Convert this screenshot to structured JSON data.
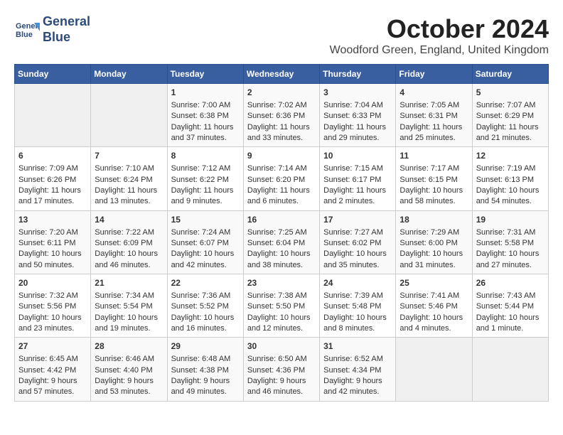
{
  "logo": {
    "line1": "General",
    "line2": "Blue"
  },
  "title": "October 2024",
  "location": "Woodford Green, England, United Kingdom",
  "headers": [
    "Sunday",
    "Monday",
    "Tuesday",
    "Wednesday",
    "Thursday",
    "Friday",
    "Saturday"
  ],
  "weeks": [
    [
      {
        "day": "",
        "sunrise": "",
        "sunset": "",
        "daylight": ""
      },
      {
        "day": "",
        "sunrise": "",
        "sunset": "",
        "daylight": ""
      },
      {
        "day": "1",
        "sunrise": "Sunrise: 7:00 AM",
        "sunset": "Sunset: 6:38 PM",
        "daylight": "Daylight: 11 hours and 37 minutes."
      },
      {
        "day": "2",
        "sunrise": "Sunrise: 7:02 AM",
        "sunset": "Sunset: 6:36 PM",
        "daylight": "Daylight: 11 hours and 33 minutes."
      },
      {
        "day": "3",
        "sunrise": "Sunrise: 7:04 AM",
        "sunset": "Sunset: 6:33 PM",
        "daylight": "Daylight: 11 hours and 29 minutes."
      },
      {
        "day": "4",
        "sunrise": "Sunrise: 7:05 AM",
        "sunset": "Sunset: 6:31 PM",
        "daylight": "Daylight: 11 hours and 25 minutes."
      },
      {
        "day": "5",
        "sunrise": "Sunrise: 7:07 AM",
        "sunset": "Sunset: 6:29 PM",
        "daylight": "Daylight: 11 hours and 21 minutes."
      }
    ],
    [
      {
        "day": "6",
        "sunrise": "Sunrise: 7:09 AM",
        "sunset": "Sunset: 6:26 PM",
        "daylight": "Daylight: 11 hours and 17 minutes."
      },
      {
        "day": "7",
        "sunrise": "Sunrise: 7:10 AM",
        "sunset": "Sunset: 6:24 PM",
        "daylight": "Daylight: 11 hours and 13 minutes."
      },
      {
        "day": "8",
        "sunrise": "Sunrise: 7:12 AM",
        "sunset": "Sunset: 6:22 PM",
        "daylight": "Daylight: 11 hours and 9 minutes."
      },
      {
        "day": "9",
        "sunrise": "Sunrise: 7:14 AM",
        "sunset": "Sunset: 6:20 PM",
        "daylight": "Daylight: 11 hours and 6 minutes."
      },
      {
        "day": "10",
        "sunrise": "Sunrise: 7:15 AM",
        "sunset": "Sunset: 6:17 PM",
        "daylight": "Daylight: 11 hours and 2 minutes."
      },
      {
        "day": "11",
        "sunrise": "Sunrise: 7:17 AM",
        "sunset": "Sunset: 6:15 PM",
        "daylight": "Daylight: 10 hours and 58 minutes."
      },
      {
        "day": "12",
        "sunrise": "Sunrise: 7:19 AM",
        "sunset": "Sunset: 6:13 PM",
        "daylight": "Daylight: 10 hours and 54 minutes."
      }
    ],
    [
      {
        "day": "13",
        "sunrise": "Sunrise: 7:20 AM",
        "sunset": "Sunset: 6:11 PM",
        "daylight": "Daylight: 10 hours and 50 minutes."
      },
      {
        "day": "14",
        "sunrise": "Sunrise: 7:22 AM",
        "sunset": "Sunset: 6:09 PM",
        "daylight": "Daylight: 10 hours and 46 minutes."
      },
      {
        "day": "15",
        "sunrise": "Sunrise: 7:24 AM",
        "sunset": "Sunset: 6:07 PM",
        "daylight": "Daylight: 10 hours and 42 minutes."
      },
      {
        "day": "16",
        "sunrise": "Sunrise: 7:25 AM",
        "sunset": "Sunset: 6:04 PM",
        "daylight": "Daylight: 10 hours and 38 minutes."
      },
      {
        "day": "17",
        "sunrise": "Sunrise: 7:27 AM",
        "sunset": "Sunset: 6:02 PM",
        "daylight": "Daylight: 10 hours and 35 minutes."
      },
      {
        "day": "18",
        "sunrise": "Sunrise: 7:29 AM",
        "sunset": "Sunset: 6:00 PM",
        "daylight": "Daylight: 10 hours and 31 minutes."
      },
      {
        "day": "19",
        "sunrise": "Sunrise: 7:31 AM",
        "sunset": "Sunset: 5:58 PM",
        "daylight": "Daylight: 10 hours and 27 minutes."
      }
    ],
    [
      {
        "day": "20",
        "sunrise": "Sunrise: 7:32 AM",
        "sunset": "Sunset: 5:56 PM",
        "daylight": "Daylight: 10 hours and 23 minutes."
      },
      {
        "day": "21",
        "sunrise": "Sunrise: 7:34 AM",
        "sunset": "Sunset: 5:54 PM",
        "daylight": "Daylight: 10 hours and 19 minutes."
      },
      {
        "day": "22",
        "sunrise": "Sunrise: 7:36 AM",
        "sunset": "Sunset: 5:52 PM",
        "daylight": "Daylight: 10 hours and 16 minutes."
      },
      {
        "day": "23",
        "sunrise": "Sunrise: 7:38 AM",
        "sunset": "Sunset: 5:50 PM",
        "daylight": "Daylight: 10 hours and 12 minutes."
      },
      {
        "day": "24",
        "sunrise": "Sunrise: 7:39 AM",
        "sunset": "Sunset: 5:48 PM",
        "daylight": "Daylight: 10 hours and 8 minutes."
      },
      {
        "day": "25",
        "sunrise": "Sunrise: 7:41 AM",
        "sunset": "Sunset: 5:46 PM",
        "daylight": "Daylight: 10 hours and 4 minutes."
      },
      {
        "day": "26",
        "sunrise": "Sunrise: 7:43 AM",
        "sunset": "Sunset: 5:44 PM",
        "daylight": "Daylight: 10 hours and 1 minute."
      }
    ],
    [
      {
        "day": "27",
        "sunrise": "Sunrise: 6:45 AM",
        "sunset": "Sunset: 4:42 PM",
        "daylight": "Daylight: 9 hours and 57 minutes."
      },
      {
        "day": "28",
        "sunrise": "Sunrise: 6:46 AM",
        "sunset": "Sunset: 4:40 PM",
        "daylight": "Daylight: 9 hours and 53 minutes."
      },
      {
        "day": "29",
        "sunrise": "Sunrise: 6:48 AM",
        "sunset": "Sunset: 4:38 PM",
        "daylight": "Daylight: 9 hours and 49 minutes."
      },
      {
        "day": "30",
        "sunrise": "Sunrise: 6:50 AM",
        "sunset": "Sunset: 4:36 PM",
        "daylight": "Daylight: 9 hours and 46 minutes."
      },
      {
        "day": "31",
        "sunrise": "Sunrise: 6:52 AM",
        "sunset": "Sunset: 4:34 PM",
        "daylight": "Daylight: 9 hours and 42 minutes."
      },
      {
        "day": "",
        "sunrise": "",
        "sunset": "",
        "daylight": ""
      },
      {
        "day": "",
        "sunrise": "",
        "sunset": "",
        "daylight": ""
      }
    ]
  ]
}
